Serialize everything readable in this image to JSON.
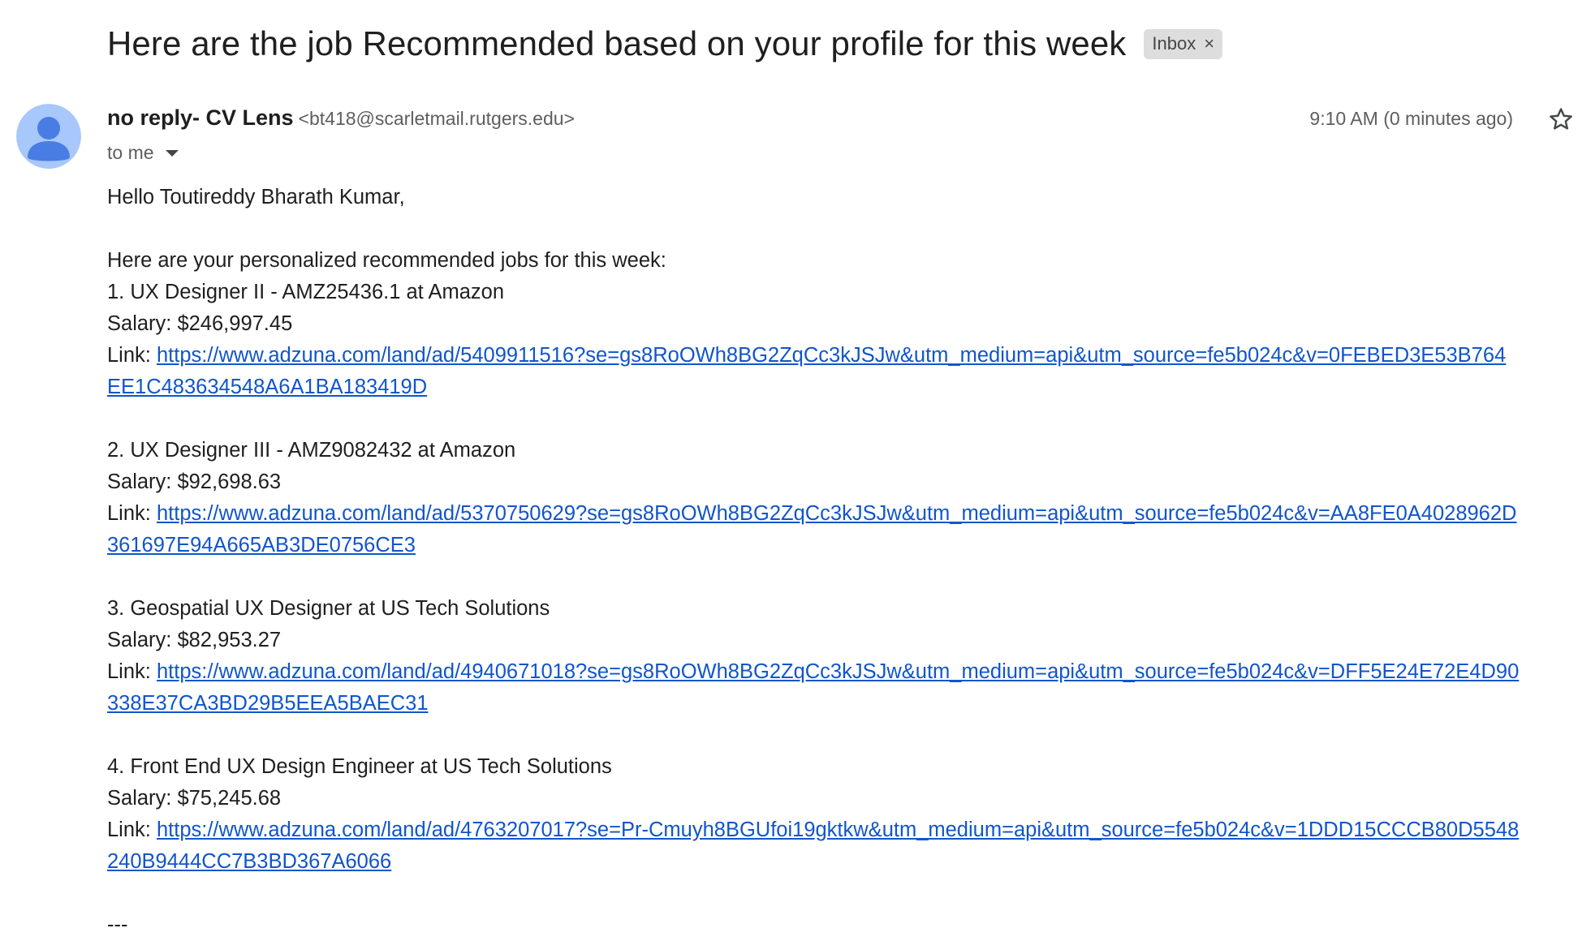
{
  "email": {
    "subject": "Here are the job Recommended based on your profile for this week",
    "label": "Inbox",
    "sender_name": "no reply- CV Lens",
    "sender_email": "<bt418@scarletmail.rutgers.edu>",
    "to": "to me",
    "timestamp": "9:10 AM (0 minutes ago)",
    "greeting": "Hello Toutireddy Bharath Kumar,",
    "intro": "Here are your personalized recommended jobs for this week:",
    "jobs": [
      {
        "title": "1. UX Designer II - AMZ25436.1 at Amazon",
        "salary": "Salary: $246,997.45",
        "link_label": "Link:",
        "url": "https://www.adzuna.com/land/ad/5409911516?se=gs8RoOWh8BG2ZqCc3kJSJw&utm_medium=api&utm_source=fe5b024c&v=0FEBED3E53B764EE1C483634548A6A1BA183419D"
      },
      {
        "title": "2. UX Designer III - AMZ9082432 at Amazon",
        "salary": "Salary: $92,698.63",
        "link_label": "Link:",
        "url": "https://www.adzuna.com/land/ad/5370750629?se=gs8RoOWh8BG2ZqCc3kJSJw&utm_medium=api&utm_source=fe5b024c&v=AA8FE0A4028962D361697E94A665AB3DE0756CE3"
      },
      {
        "title": "3. Geospatial UX Designer at US Tech Solutions",
        "salary": "Salary: $82,953.27",
        "link_label": "Link:",
        "url": "https://www.adzuna.com/land/ad/4940671018?se=gs8RoOWh8BG2ZqCc3kJSJw&utm_medium=api&utm_source=fe5b024c&v=DFF5E24E72E4D90338E37CA3BD29B5EEA5BAEC31"
      },
      {
        "title": "4. Front End UX Design Engineer at US Tech Solutions",
        "salary": "Salary: $75,245.68",
        "link_label": "Link:",
        "url": "https://www.adzuna.com/land/ad/4763207017?se=Pr-Cmuyh8BGUfoi19gktkw&utm_medium=api&utm_source=fe5b024c&v=1DDD15CCCB80D5548240B9444CC7B3BD367A6066"
      }
    ],
    "signature_separator": "---"
  },
  "icons": {
    "avatar": "person-avatar-icon",
    "label_close": "close-icon",
    "recipients_toggle": "chevron-down-icon",
    "star": "star-icon"
  },
  "colors": {
    "link": "#1155cc",
    "avatar_bg": "#a8c7fa",
    "avatar_fg": "#4a7de3",
    "chip_bg": "#dddddd"
  }
}
